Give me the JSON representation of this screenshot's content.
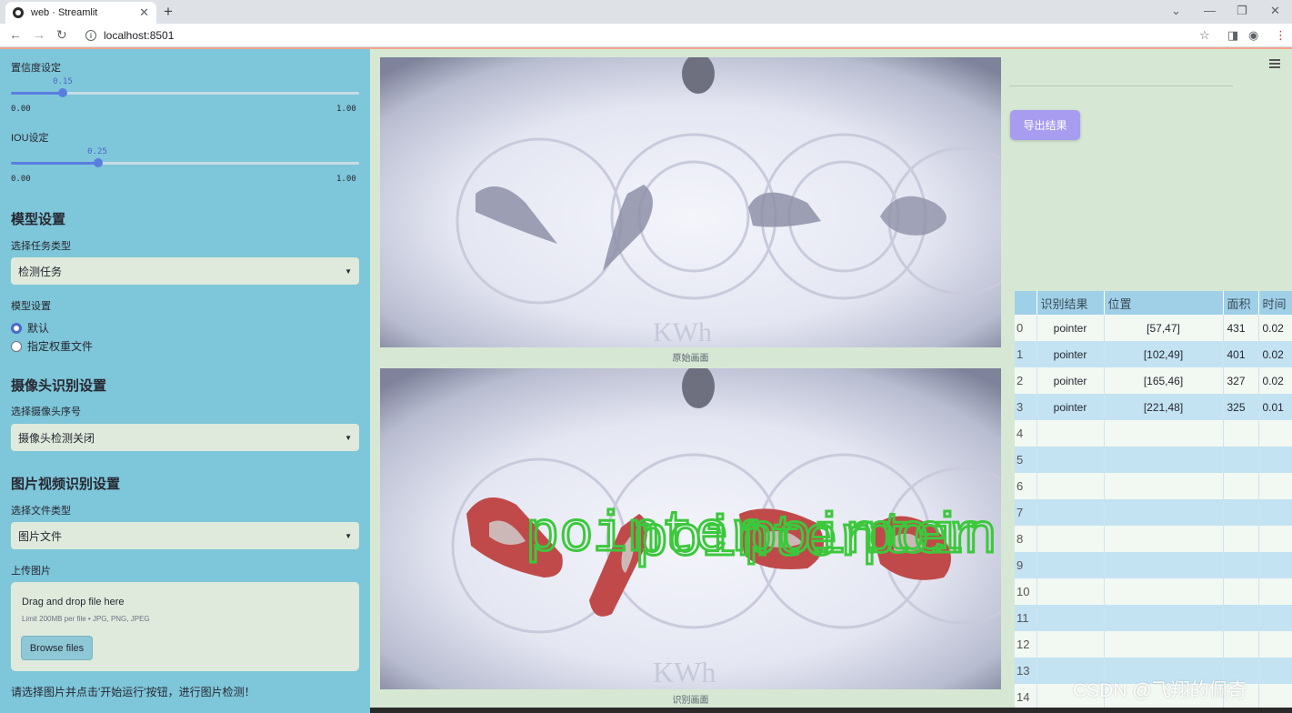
{
  "browser": {
    "tab_title": "web · Streamlit",
    "tab_close": "✕",
    "new_tab": "+",
    "url": "localhost:8501",
    "window_controls": [
      "⌄",
      "—",
      "❐",
      "✕"
    ]
  },
  "sidebar": {
    "confidence": {
      "label": "置信度设定",
      "value": "0.15",
      "value_num": 0.15,
      "min": "0.00",
      "max": "1.00"
    },
    "iou": {
      "label": "IOU设定",
      "value": "0.25",
      "value_num": 0.25,
      "min": "0.00",
      "max": "1.00"
    },
    "model_section": {
      "heading": "模型设置",
      "task_label": "选择任务类型",
      "task_value": "检测任务",
      "weight_label": "模型设置",
      "weight_options": [
        "默认",
        "指定权重文件"
      ],
      "weight_selected": "默认"
    },
    "camera_section": {
      "heading": "摄像头识别设置",
      "camera_label": "选择摄像头序号",
      "camera_value": "摄像头检测关闭"
    },
    "media_section": {
      "heading": "图片视频识别设置",
      "file_type_label": "选择文件类型",
      "file_type_value": "图片文件",
      "upload_label": "上传图片",
      "drop_title": "Drag and drop file here",
      "drop_limit": "Limit 200MB per file • JPG, PNG, JPEG",
      "browse_label": "Browse files"
    },
    "hint": "请选择图片并点击'开始运行'按钮，进行图片检测！"
  },
  "main": {
    "original_caption": "原始画面",
    "result_caption": "识别画面",
    "export_label": "导出结果",
    "overlay_text": "pointer",
    "overlay_color": "#3cc83c",
    "mask_color": "#c04a4a",
    "table": {
      "columns": [
        "",
        "识别结果",
        "位置",
        "面积",
        "时间"
      ],
      "rows": [
        [
          "0",
          "pointer",
          "[57,47]",
          "431",
          "0.02"
        ],
        [
          "1",
          "pointer",
          "[102,49]",
          "401",
          "0.02"
        ],
        [
          "2",
          "pointer",
          "[165,46]",
          "327",
          "0.02"
        ],
        [
          "3",
          "pointer",
          "[221,48]",
          "325",
          "0.01"
        ],
        [
          "4",
          "",
          "",
          "",
          ""
        ],
        [
          "5",
          "",
          "",
          "",
          ""
        ],
        [
          "6",
          "",
          "",
          "",
          ""
        ],
        [
          "7",
          "",
          "",
          "",
          ""
        ],
        [
          "8",
          "",
          "",
          "",
          ""
        ],
        [
          "9",
          "",
          "",
          "",
          ""
        ],
        [
          "10",
          "",
          "",
          "",
          ""
        ],
        [
          "11",
          "",
          "",
          "",
          ""
        ],
        [
          "12",
          "",
          "",
          "",
          ""
        ],
        [
          "13",
          "",
          "",
          "",
          ""
        ],
        [
          "14",
          "",
          "",
          "",
          ""
        ]
      ]
    }
  },
  "watermark": "CSDN @飞翔的佩奇"
}
